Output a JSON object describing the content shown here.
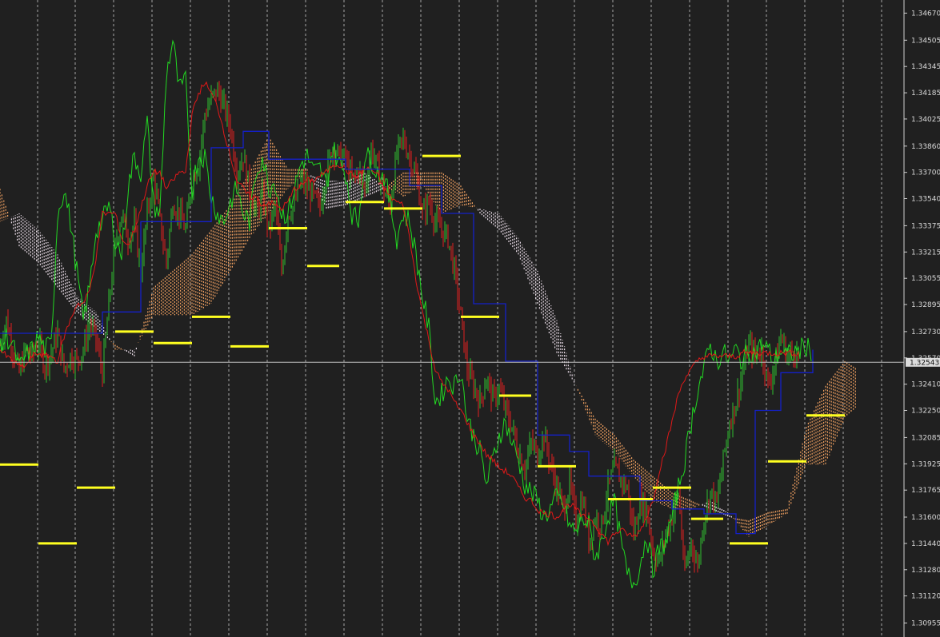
{
  "chart_data": {
    "type": "line",
    "title": "",
    "xlabel": "",
    "ylabel": "",
    "ylim": [
      1.3087,
      1.3475
    ],
    "y_ticks": [
      "1.34670",
      "1.34505",
      "1.34345",
      "1.34185",
      "1.34025",
      "1.33860",
      "1.33700",
      "1.33540",
      "1.33375",
      "1.33215",
      "1.33055",
      "1.32895",
      "1.32730",
      "1.32570",
      "1.32410",
      "1.32250",
      "1.32085",
      "1.31925",
      "1.31765",
      "1.31600",
      "1.31440",
      "1.31280",
      "1.31120",
      "1.30955"
    ],
    "current_price": "1.32543",
    "grid": "vertical dashed",
    "x": [
      0,
      8,
      16,
      24,
      32,
      40,
      48,
      56,
      64,
      72,
      80,
      88,
      96,
      104,
      112,
      120,
      128,
      136,
      144,
      152,
      160,
      168,
      176,
      184,
      192,
      200,
      208,
      216,
      224,
      232,
      240,
      248,
      256,
      264,
      272,
      280,
      288,
      296,
      304,
      312,
      320,
      328,
      336,
      344,
      352,
      360,
      368,
      376,
      384,
      392,
      400,
      408,
      416,
      424,
      432,
      440,
      448,
      456,
      464,
      472,
      480,
      488,
      496,
      504,
      512,
      520,
      528,
      536,
      544,
      552,
      560,
      568,
      576,
      584,
      592,
      600,
      608,
      616,
      624,
      632,
      640,
      648,
      656,
      664,
      672,
      680,
      688,
      696,
      704,
      712,
      720,
      728,
      736,
      744,
      752,
      760,
      768,
      776,
      784,
      792,
      800,
      808,
      816,
      824,
      832,
      840,
      848,
      856,
      864,
      872,
      880,
      888,
      896,
      904,
      912,
      920,
      928,
      936,
      944,
      952,
      960,
      968,
      976,
      984,
      992,
      1000,
      1008,
      1016
    ],
    "series": [
      {
        "type": "candles",
        "color_up": "#2fbf2f",
        "color_down": "#e02020",
        "close": [
          1.3265,
          1.328,
          1.3262,
          1.3248,
          1.3262,
          1.3258,
          1.3267,
          1.3252,
          1.326,
          1.3272,
          1.325,
          1.3258,
          1.3255,
          1.3262,
          1.3278,
          1.3268,
          1.3248,
          1.329,
          1.3325,
          1.3345,
          1.333,
          1.3338,
          1.331,
          1.3345,
          1.3368,
          1.334,
          1.3315,
          1.3352,
          1.3345,
          1.3335,
          1.3365,
          1.3375,
          1.3405,
          1.3415,
          1.342,
          1.341,
          1.3398,
          1.337,
          1.338,
          1.336,
          1.3345,
          1.3355,
          1.3335,
          1.335,
          1.331,
          1.3345,
          1.335,
          1.3365,
          1.336,
          1.3355,
          1.3348,
          1.3372,
          1.3385,
          1.338,
          1.3378,
          1.3365,
          1.3372,
          1.336,
          1.3385,
          1.3372,
          1.3358,
          1.335,
          1.3382,
          1.339,
          1.338,
          1.3368,
          1.3345,
          1.3352,
          1.334,
          1.3335,
          1.333,
          1.331,
          1.3282,
          1.325,
          1.324,
          1.323,
          1.3245,
          1.3232,
          1.3238,
          1.3225,
          1.3215,
          1.32,
          1.319,
          1.3205,
          1.3198,
          1.321,
          1.3192,
          1.3178,
          1.3165,
          1.318,
          1.3158,
          1.3172,
          1.3145,
          1.316,
          1.3155,
          1.3178,
          1.319,
          1.3183,
          1.3178,
          1.315,
          1.317,
          1.3165,
          1.314,
          1.3132,
          1.315,
          1.316,
          1.3175,
          1.3125,
          1.3145,
          1.313,
          1.316,
          1.3175,
          1.3168,
          1.3195,
          1.3218,
          1.323,
          1.3248,
          1.3265,
          1.3258,
          1.3262,
          1.324,
          1.3252,
          1.327,
          1.3258,
          1.3262,
          1.3255
        ]
      },
      {
        "name": "",
        "color": "#22d822",
        "values": [
          1.3262,
          1.327,
          1.3265,
          1.325,
          1.3258,
          1.3262,
          1.327,
          1.3262,
          1.3265,
          1.3345,
          1.336,
          1.334,
          1.331,
          1.328,
          1.33,
          1.3335,
          1.334,
          1.335,
          1.333,
          1.332,
          1.336,
          1.338,
          1.337,
          1.34,
          1.335,
          1.3345,
          1.343,
          1.345,
          1.342,
          1.3425,
          1.336,
          1.338,
          1.338,
          1.3355,
          1.3345,
          1.334,
          1.3352,
          1.336,
          1.3345,
          1.334,
          1.337,
          1.338,
          1.336,
          1.3365,
          1.3345,
          1.3345,
          1.336,
          1.3375,
          1.338,
          1.337,
          1.3372,
          1.3362,
          1.3385,
          1.3375,
          1.337,
          1.3345,
          1.334,
          1.338,
          1.3378,
          1.337,
          1.3368,
          1.335,
          1.333,
          1.3345,
          1.334,
          1.332,
          1.3295,
          1.3275,
          1.323,
          1.3235,
          1.3245,
          1.324,
          1.325,
          1.322,
          1.321,
          1.32,
          1.318,
          1.3195,
          1.321,
          1.3218,
          1.3205,
          1.3195,
          1.318,
          1.3175,
          1.317,
          1.316,
          1.3165,
          1.3172,
          1.3168,
          1.3155,
          1.315,
          1.316,
          1.3155,
          1.3135,
          1.3145,
          1.316,
          1.317,
          1.3145,
          1.3125,
          1.312,
          1.313,
          1.315,
          1.3128,
          1.314,
          1.3145,
          1.316,
          1.3178,
          1.3195,
          1.3218,
          1.3238,
          1.325,
          1.3265,
          1.3255,
          1.326,
          1.3255,
          1.3262,
          1.3255,
          1.3262,
          1.326,
          1.3265,
          1.3262,
          1.3255,
          1.3262,
          1.3258,
          1.326,
          1.3262,
          1.3265,
          1.326
        ]
      },
      {
        "name": "",
        "color": "#e01818",
        "values": [
          1.3262,
          1.3258,
          1.3255,
          1.3252,
          1.3252,
          1.3258,
          1.326,
          1.3258,
          1.3258,
          1.3255,
          1.327,
          1.328,
          1.329,
          1.329,
          1.3298,
          1.3318,
          1.3345,
          1.3345,
          1.3345,
          1.333,
          1.3325,
          1.3335,
          1.3348,
          1.3362,
          1.337,
          1.337,
          1.336,
          1.3365,
          1.337,
          1.337,
          1.3405,
          1.3418,
          1.3425,
          1.3418,
          1.341,
          1.3395,
          1.338,
          1.3365,
          1.336,
          1.3355,
          1.3355,
          1.335,
          1.3352,
          1.335,
          1.3348,
          1.3352,
          1.336,
          1.3362,
          1.3365,
          1.3365,
          1.3368,
          1.337,
          1.3375,
          1.3375,
          1.3372,
          1.3368,
          1.3368,
          1.3372,
          1.3372,
          1.3368,
          1.336,
          1.3355,
          1.3352,
          1.335,
          1.333,
          1.3305,
          1.3285,
          1.3268,
          1.325,
          1.3242,
          1.3238,
          1.323,
          1.3225,
          1.3218,
          1.321,
          1.3205,
          1.3198,
          1.3195,
          1.319,
          1.3188,
          1.3185,
          1.3178,
          1.3172,
          1.317,
          1.3165,
          1.3162,
          1.3162,
          1.316,
          1.3165,
          1.3168,
          1.3165,
          1.316,
          1.316,
          1.3155,
          1.315,
          1.3145,
          1.315,
          1.3152,
          1.315,
          1.3148,
          1.3152,
          1.316,
          1.317,
          1.3188,
          1.3202,
          1.3218,
          1.3235,
          1.3245,
          1.325,
          1.3255,
          1.3258,
          1.3258,
          1.3258,
          1.3258,
          1.3258,
          1.3258,
          1.326,
          1.326,
          1.326,
          1.326,
          1.326,
          1.326,
          1.326,
          1.326,
          1.326,
          1.326
        ]
      },
      {
        "name": "",
        "color": "#1420c8",
        "step": [
          [
            0,
            1.3272
          ],
          [
            16,
            1.3272
          ],
          [
            48,
            1.3272
          ],
          [
            128,
            1.3285
          ],
          [
            176,
            1.334
          ],
          [
            216,
            1.334
          ],
          [
            264,
            1.3385
          ],
          [
            304,
            1.3395
          ],
          [
            336,
            1.3378
          ],
          [
            392,
            1.3378
          ],
          [
            432,
            1.3372
          ],
          [
            512,
            1.3362
          ],
          [
            552,
            1.3345
          ],
          [
            592,
            1.329
          ],
          [
            632,
            1.3255
          ],
          [
            672,
            1.321
          ],
          [
            712,
            1.32
          ],
          [
            736,
            1.3185
          ],
          [
            800,
            1.317
          ],
          [
            840,
            1.3165
          ],
          [
            880,
            1.3162
          ],
          [
            920,
            1.315
          ],
          [
            944,
            1.3225
          ],
          [
            976,
            1.3248
          ],
          [
            1016,
            1.3262
          ]
        ]
      },
      {
        "name": "",
        "color": "#ffff20",
        "segments": [
          [
            0,
            48,
            1.3192
          ],
          [
            48,
            96,
            1.3144
          ],
          [
            96,
            144,
            1.3178
          ],
          [
            144,
            192,
            1.3273
          ],
          [
            192,
            240,
            1.3266
          ],
          [
            240,
            288,
            1.3282
          ],
          [
            288,
            336,
            1.3264
          ],
          [
            336,
            384,
            1.3336
          ],
          [
            384,
            424,
            1.3313
          ],
          [
            432,
            480,
            1.3352
          ],
          [
            480,
            528,
            1.3348
          ],
          [
            528,
            576,
            1.338
          ],
          [
            576,
            624,
            1.3282
          ],
          [
            624,
            664,
            1.3234
          ],
          [
            672,
            720,
            1.3191
          ],
          [
            760,
            816,
            1.3171
          ],
          [
            816,
            864,
            1.3178
          ],
          [
            864,
            904,
            1.3159
          ],
          [
            912,
            960,
            1.3144
          ],
          [
            960,
            1008,
            1.3194
          ],
          [
            1008,
            1056,
            1.3222
          ]
        ]
      }
    ],
    "cloud": {
      "colors": {
        "bull": "#f0a060",
        "bear": "#e8dbe6"
      },
      "x": [
        0,
        24,
        48,
        72,
        96,
        120,
        144,
        168,
        192,
        216,
        240,
        264,
        288,
        312,
        336,
        360,
        384,
        408,
        432,
        456,
        480,
        504,
        528,
        552,
        576,
        600,
        624,
        648,
        672,
        696,
        720,
        744,
        768,
        792,
        816,
        840,
        864,
        888,
        912,
        936,
        960,
        984,
        1008,
        1032,
        1056,
        1072
      ],
      "a": [
        1.336,
        1.3325,
        1.3315,
        1.33,
        1.3285,
        1.3275,
        1.3265,
        1.3258,
        1.33,
        1.331,
        1.332,
        1.3335,
        1.335,
        1.337,
        1.3392,
        1.3372,
        1.3372,
        1.3348,
        1.335,
        1.3355,
        1.336,
        1.337,
        1.337,
        1.337,
        1.3362,
        1.3345,
        1.3335,
        1.332,
        1.329,
        1.326,
        1.324,
        1.322,
        1.321,
        1.3195,
        1.3185,
        1.3175,
        1.317,
        1.3165,
        1.316,
        1.3158,
        1.3163,
        1.3165,
        1.3215,
        1.324,
        1.3255,
        1.325
      ],
      "b": [
        1.334,
        1.3345,
        1.3335,
        1.332,
        1.3295,
        1.3285,
        1.3262,
        1.3262,
        1.3283,
        1.3283,
        1.3283,
        1.329,
        1.331,
        1.333,
        1.3345,
        1.336,
        1.337,
        1.3365,
        1.3365,
        1.337,
        1.3362,
        1.3355,
        1.3362,
        1.3345,
        1.335,
        1.3348,
        1.3345,
        1.333,
        1.331,
        1.328,
        1.324,
        1.321,
        1.32,
        1.3185,
        1.317,
        1.3165,
        1.3165,
        1.317,
        1.3162,
        1.3148,
        1.3155,
        1.3162,
        1.3192,
        1.3192,
        1.322,
        1.3228
      ]
    }
  }
}
